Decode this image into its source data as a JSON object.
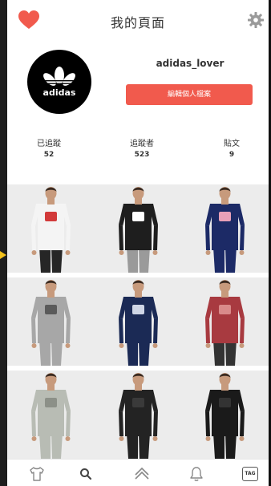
{
  "header": {
    "title": "我的頁面"
  },
  "profile": {
    "username": "adidas_lover",
    "avatar_text": "adidas",
    "action_button": "編輯個人檔案"
  },
  "stats": [
    {
      "label": "已追蹤",
      "value": "52"
    },
    {
      "label": "追蹤者",
      "value": "523"
    },
    {
      "label": "貼文",
      "value": "9"
    }
  ],
  "posts": [
    {
      "shirt": "#f4f4f4",
      "pants": "#262626",
      "graphic": "#d23a3a"
    },
    {
      "shirt": "#1e1e1e",
      "pants": "#9a9a9a",
      "graphic": "#ffffff"
    },
    {
      "shirt": "#1c2a66",
      "pants": "#1c2a66",
      "graphic": "#e8a0b8"
    },
    {
      "shirt": "#a7a7a7",
      "pants": "#a7a7a7",
      "graphic": "#5a5a5a"
    },
    {
      "shirt": "#1b2a55",
      "pants": "#1b2a55",
      "graphic": "#cfd6e6"
    },
    {
      "shirt": "#a83a40",
      "pants": "#333333",
      "graphic": "#d98a8a"
    },
    {
      "shirt": "#b8bcb4",
      "pants": "#b8bcb4",
      "graphic": "#8c9088"
    },
    {
      "shirt": "#232323",
      "pants": "#232323",
      "graphic": "#3a3a3a"
    },
    {
      "shirt": "#1a1a1a",
      "pants": "#1a1a1a",
      "graphic": "#333333"
    }
  ],
  "nav": {
    "items": [
      "shirt-icon",
      "search-icon",
      "home-icon",
      "bell-icon",
      "tag-icon"
    ],
    "tag_text": "TAG"
  },
  "colors": {
    "accent": "#f15a4d"
  }
}
